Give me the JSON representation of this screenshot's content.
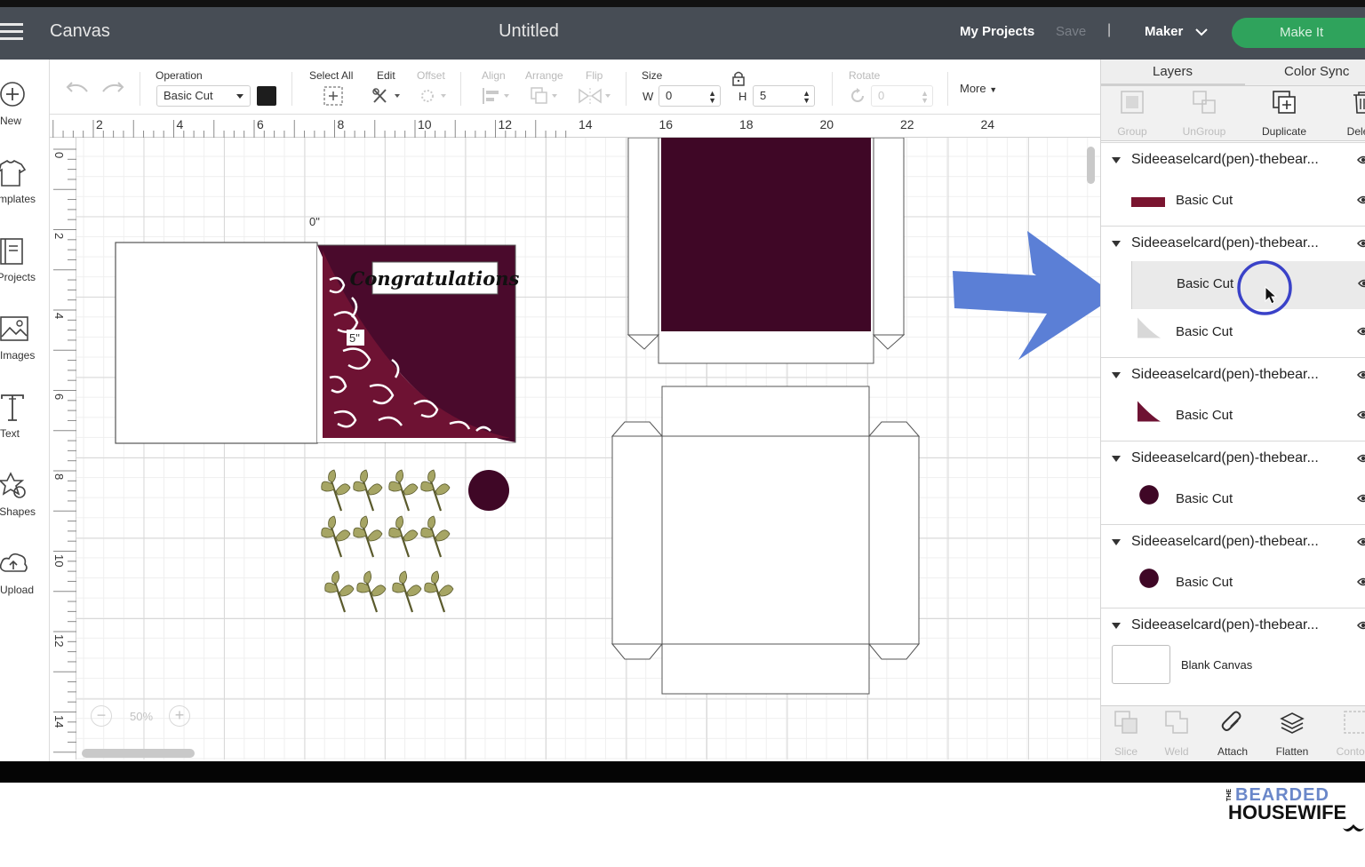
{
  "header": {
    "app_name": "Canvas",
    "doc_title": "Untitled",
    "my_projects": "My Projects",
    "save": "Save",
    "separator": "|",
    "machine": "Maker",
    "make_it": "Make It"
  },
  "toolbar": {
    "operation_label": "Operation",
    "operation_value": "Basic Cut",
    "select_all": "Select All",
    "edit": "Edit",
    "offset": "Offset",
    "align": "Align",
    "arrange": "Arrange",
    "flip": "Flip",
    "size": "Size",
    "w_label": "W",
    "w_value": "0",
    "h_label": "H",
    "h_value": "5",
    "rotate": "Rotate",
    "rotate_value": "0",
    "more": "More"
  },
  "left_sidebar": [
    {
      "label": "New",
      "icon": "plus-circle-icon"
    },
    {
      "label": "Templates",
      "icon": "shirt-icon"
    },
    {
      "label": "Projects",
      "icon": "book-icon"
    },
    {
      "label": "Images",
      "icon": "image-icon"
    },
    {
      "label": "Text",
      "icon": "text-icon"
    },
    {
      "label": "Shapes",
      "icon": "shapes-icon"
    },
    {
      "label": "Upload",
      "icon": "cloud-upload-icon"
    }
  ],
  "rulers": {
    "top": [
      "2",
      "4",
      "6",
      "8",
      "10",
      "12",
      "14",
      "16",
      "18",
      "20",
      "22",
      "24"
    ],
    "left": [
      "0",
      "2",
      "4",
      "6",
      "8",
      "10",
      "12",
      "14"
    ]
  },
  "canvas": {
    "dimension_top": "0\"",
    "dimension_side": "5\"",
    "card_text": "Congratulations",
    "colors": {
      "burgundy": "#4a0a2c",
      "wine": "#6e1233",
      "leaf": "#a6a564",
      "circle": "#3f0726"
    }
  },
  "zoom": {
    "minus": "−",
    "value": "50%",
    "plus": "+"
  },
  "panel": {
    "tabs": [
      "Layers",
      "Color Sync"
    ],
    "tools": [
      {
        "label": "Group",
        "enabled": false
      },
      {
        "label": "UnGroup",
        "enabled": false
      },
      {
        "label": "Duplicate",
        "enabled": true
      },
      {
        "label": "Delete",
        "enabled": true
      }
    ],
    "groups": [
      {
        "name": "Sideeaselcard(pen)-thebear...",
        "layers": [
          {
            "name": "Basic Cut",
            "color": "#7a1530",
            "shape": "bar"
          }
        ]
      },
      {
        "name": "Sideeaselcard(pen)-thebear...",
        "layers": [
          {
            "name": "Basic Cut",
            "color": "#ffffff",
            "shape": "blank",
            "selected": true
          },
          {
            "name": "Basic Cut",
            "color": "#d8d8d8",
            "shape": "triangle"
          }
        ]
      },
      {
        "name": "Sideeaselcard(pen)-thebear...",
        "layers": [
          {
            "name": "Basic Cut",
            "color": "#6e1233",
            "shape": "triangle"
          }
        ]
      },
      {
        "name": "Sideeaselcard(pen)-thebear...",
        "layers": [
          {
            "name": "Basic Cut",
            "color": "#3f0726",
            "shape": "circle"
          }
        ]
      },
      {
        "name": "Sideeaselcard(pen)-thebear...",
        "layers": [
          {
            "name": "Basic Cut",
            "color": "#3f0726",
            "shape": "circle"
          }
        ]
      },
      {
        "name": "Sideeaselcard(pen)-thebear...",
        "layers": []
      }
    ],
    "blank_canvas": "Blank Canvas",
    "bottom_tools": [
      {
        "label": "Slice",
        "enabled": false
      },
      {
        "label": "Weld",
        "enabled": false
      },
      {
        "label": "Attach",
        "enabled": true
      },
      {
        "label": "Flatten",
        "enabled": true
      },
      {
        "label": "Contour",
        "enabled": false
      }
    ]
  },
  "annotation": {
    "arrow_color": "#5b7fd6",
    "cursor_ring_color": "#3a42c8"
  },
  "logo": {
    "the": "THE",
    "line1": "BEARDED",
    "line2": "HOUSEWIFE"
  }
}
